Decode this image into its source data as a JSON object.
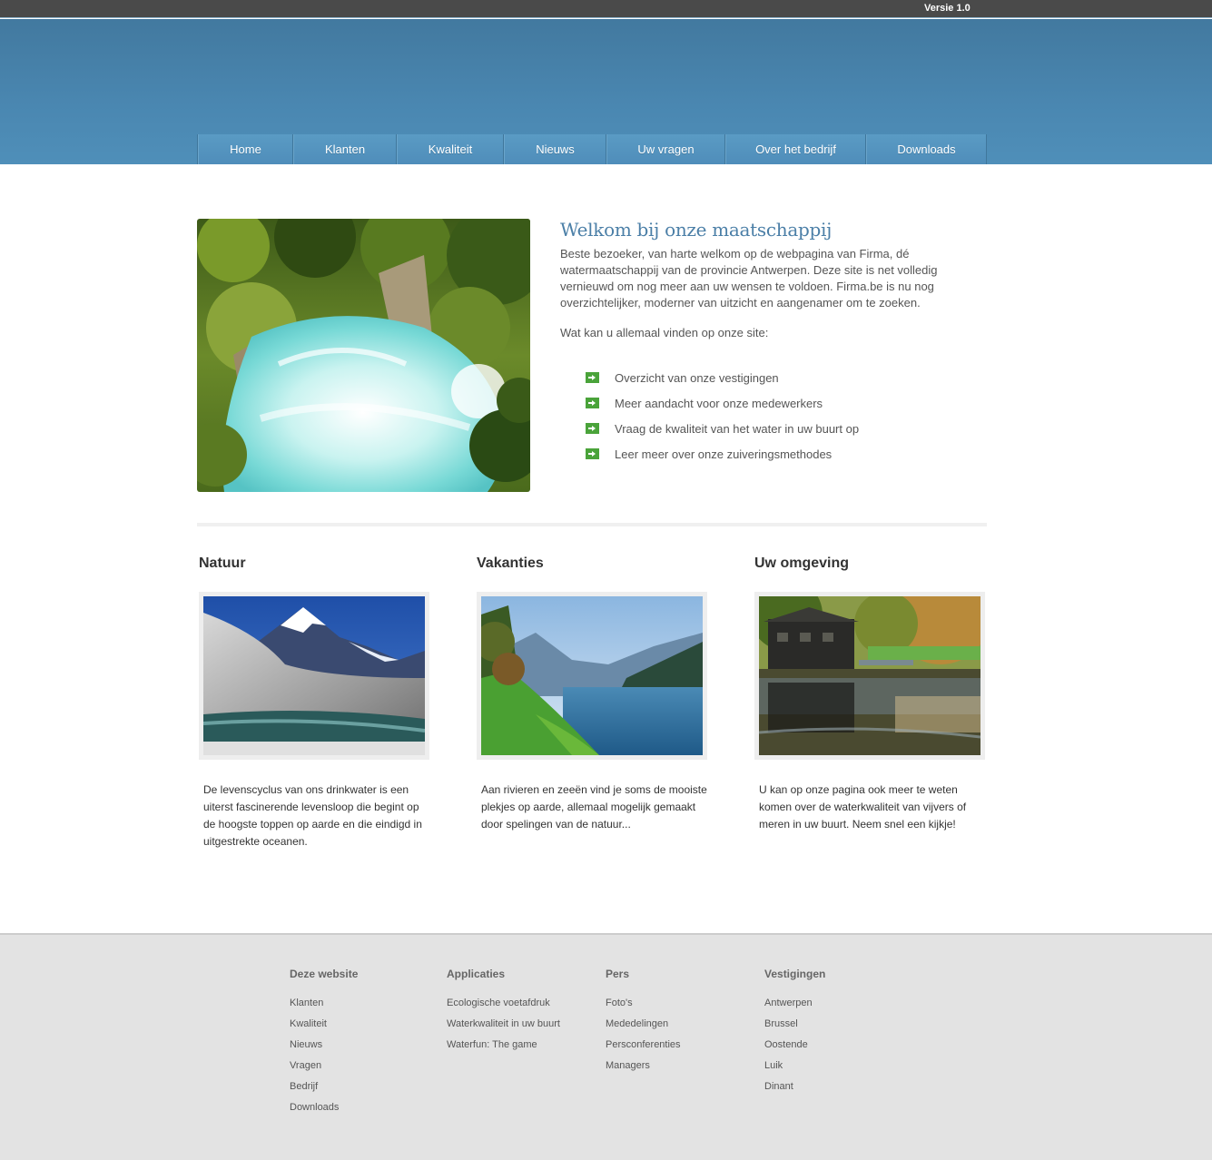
{
  "topbar": {
    "version": "Versie 1.0"
  },
  "nav": [
    "Home",
    "Klanten",
    "Kwaliteit",
    "Nieuws",
    "Uw vragen",
    "Over het bedrijf",
    "Downloads"
  ],
  "intro": {
    "title": "Welkom bij onze maatschappij",
    "paragraph": "Beste bezoeker, van harte welkom op de webpagina van Firma, dé watermaatschappij van de provincie Antwerpen. Deze site is net volledig vernieuwd om nog meer aan uw wensen te voldoen. Firma.be is nu nog overzichtelijker, moderner van uitzicht en aangenamer om te zoeken.",
    "question": "Wat kan u allemaal vinden op onze site:",
    "features": [
      "Overzicht van onze vestigingen",
      "Meer aandacht voor onze medewerkers",
      "Vraag de kwaliteit van het water in uw buurt op",
      "Leer meer over onze zuiveringsmethodes"
    ]
  },
  "columns": [
    {
      "title": "Natuur",
      "text": "De levenscyclus van ons drinkwater is een uiterst fascinerende levensloop die begint op de hoogste toppen op aarde en die eindigd in uitgestrekte oceanen."
    },
    {
      "title": "Vakanties",
      "text": "Aan rivieren en zeeën vind je soms de mooiste plekjes op aarde, allemaal mogelijk gemaakt door spelingen van de natuur..."
    },
    {
      "title": "Uw omgeving",
      "text": "U kan op onze pagina ook meer te weten komen over de waterkwaliteit van vijvers of meren in uw buurt. Neem snel een kijkje!"
    }
  ],
  "footer": {
    "deze_website": {
      "title": "Deze website",
      "links": [
        "Klanten",
        "Kwaliteit",
        "Nieuws",
        "Vragen",
        "Bedrijf",
        "Downloads"
      ]
    },
    "applicaties": {
      "title": "Applicaties",
      "links": [
        "Ecologische voetafdruk",
        "Waterkwaliteit in uw buurt",
        "Waterfun: The game"
      ]
    },
    "pers": {
      "title": "Pers",
      "links": [
        "Foto's",
        "Mededelingen",
        "Persconferenties",
        "Managers"
      ]
    },
    "vestigingen": {
      "title": "Vestigingen",
      "links": [
        "Antwerpen",
        "Brussel",
        "Oostende",
        "Luik",
        "Dinant"
      ]
    }
  },
  "colors": {
    "header": "#4a87b1",
    "title": "#4b7fa7",
    "bullet": "#4aa33a",
    "footer": "#e3e3e3"
  }
}
